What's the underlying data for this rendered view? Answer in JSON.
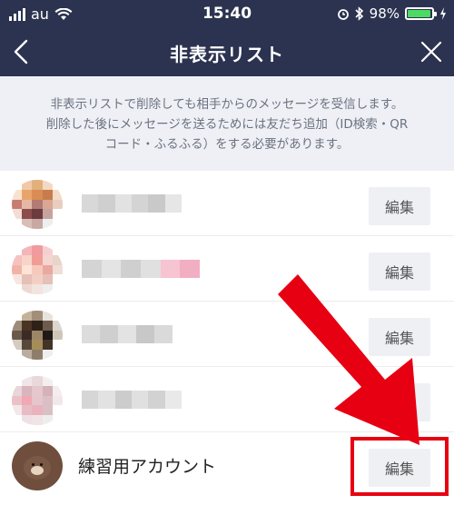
{
  "status_bar": {
    "carrier": "au",
    "time": "15:40",
    "battery_percent": "98%",
    "battery_level": 0.98
  },
  "nav": {
    "title": "非表示リスト",
    "back_icon": "chevron-left-icon",
    "close_icon": "close-icon"
  },
  "notice": {
    "line1": "非表示リストで削除しても相手からのメッセージを受信します。",
    "line2": "削除した後にメッセージを送るためには友だち追加（ID検索・QR",
    "line3": "コード・ふるふる）をする必要があります。"
  },
  "friends": [
    {
      "name": "",
      "edit_label": "編集",
      "blurred": true
    },
    {
      "name": "",
      "edit_label": "編集",
      "blurred": true
    },
    {
      "name": "",
      "edit_label": "編集",
      "blurred": true
    },
    {
      "name": "",
      "edit_label": "編集",
      "blurred": true
    },
    {
      "name": "練習用アカウント",
      "edit_label": "編集",
      "blurred": false
    }
  ],
  "colors": {
    "header_bg": "#2b3350",
    "notice_bg": "#eef0f5",
    "edit_button_bg": "#eef0f4",
    "annotation_red": "#e60012",
    "battery_green": "#4cd964"
  }
}
